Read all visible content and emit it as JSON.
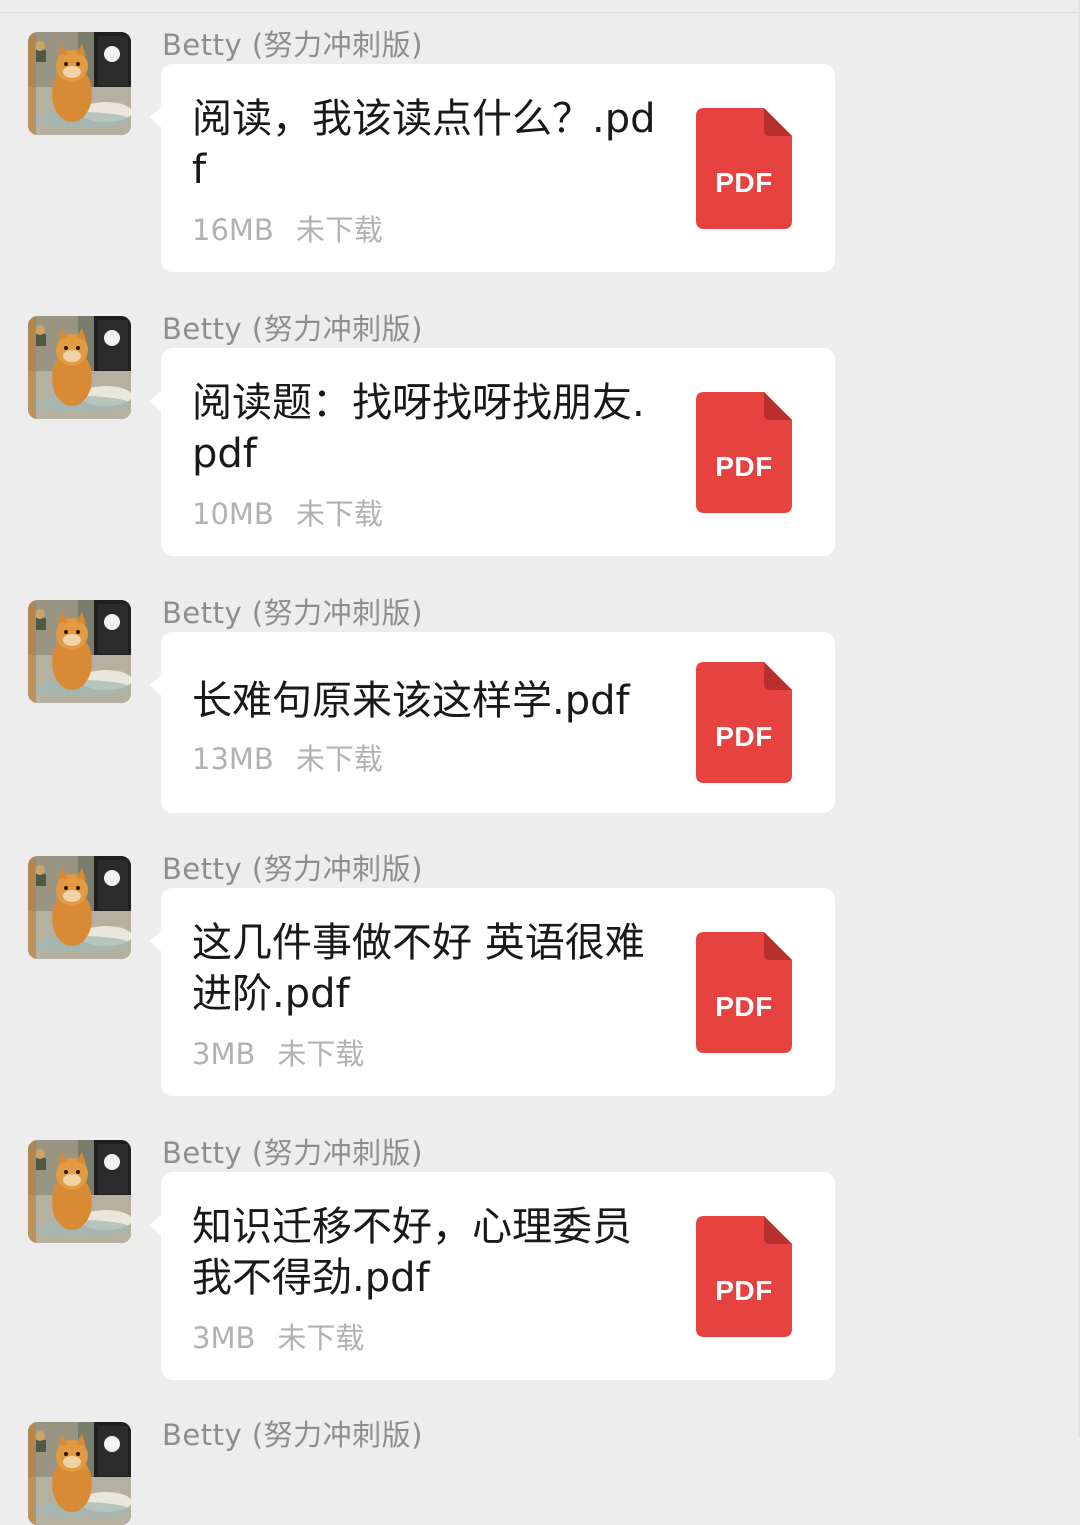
{
  "chat": {
    "messages": [
      {
        "sender": "Betty (努力冲刺版)",
        "file_name": "阅读，我该读点什么？.pdf",
        "file_size": "16MB",
        "status": "未下载",
        "file_type": "PDF"
      },
      {
        "sender": "Betty (努力冲刺版)",
        "file_name": "阅读题：找呀找呀找朋友.pdf",
        "file_size": "10MB",
        "status": "未下载",
        "file_type": "PDF"
      },
      {
        "sender": "Betty (努力冲刺版)",
        "file_name": "长难句原来该这样学.pdf",
        "file_size": "13MB",
        "status": "未下载",
        "file_type": "PDF"
      },
      {
        "sender": "Betty (努力冲刺版)",
        "file_name": "这几件事做不好 英语很难进阶.pdf",
        "file_size": "3MB",
        "status": "未下载",
        "file_type": "PDF"
      },
      {
        "sender": "Betty (努力冲刺版)",
        "file_name": "知识迁移不好，心理委员我不得劲.pdf",
        "file_size": "3MB",
        "status": "未下载",
        "file_type": "PDF"
      },
      {
        "sender": "Betty (努力冲刺版)"
      }
    ]
  },
  "colors": {
    "background": "#ededed",
    "bubble": "#ffffff",
    "pdf_red": "#e64340",
    "text_primary": "#191919",
    "text_secondary": "#b2b2b2",
    "sender_name": "#8e8e8e"
  },
  "icons": {
    "avatar": "cat-photo-avatar",
    "file": "pdf-file-icon"
  }
}
